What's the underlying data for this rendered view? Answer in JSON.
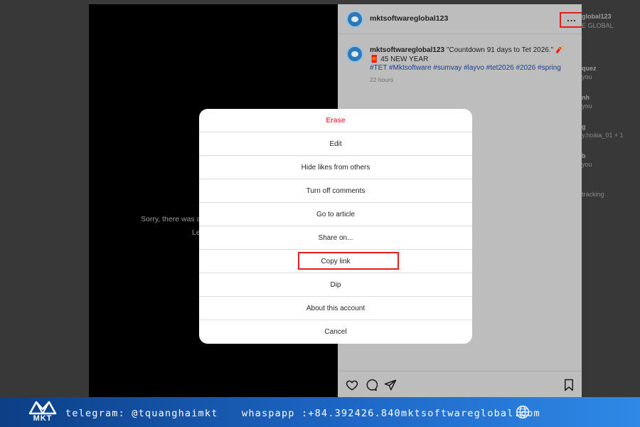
{
  "video": {
    "message_line1": "Sorry, there was a",
    "message_line2": "Le"
  },
  "post": {
    "author": "mktsoftwareglobal123",
    "more_label": "...",
    "caption_user": "mktsoftwareglobal123",
    "caption_text": "\"Countdown 91 days to Tet 2026.\" 🧨🧧 45 NEW YEAR",
    "hashtags": "#TET #Mktsoftware #sumvay #layvo #tet2026 #2026 #spring",
    "time_ago": "22 hours"
  },
  "right_column": {
    "items": [
      {
        "text": "global123",
        "bold": true
      },
      {
        "text": "E GLOBAL",
        "bold": false
      },
      {
        "text": "quez",
        "bold": true
      },
      {
        "text": "you",
        "bold": false
      },
      {
        "text": "nh",
        "bold": true
      },
      {
        "text": "you",
        "bold": false
      },
      {
        "text": "g",
        "bold": true
      },
      {
        "text": "y.hoàia_01 + 1",
        "bold": false
      },
      {
        "text": "b",
        "bold": true
      },
      {
        "text": "you",
        "bold": false
      },
      {
        "text": "tracking",
        "bold": false
      }
    ]
  },
  "modal": {
    "items": [
      {
        "label": "Erase",
        "kind": "danger"
      },
      {
        "label": "Edit",
        "kind": "normal"
      },
      {
        "label": "Hide likes from others",
        "kind": "normal"
      },
      {
        "label": "Turn off comments",
        "kind": "normal"
      },
      {
        "label": "Go to article",
        "kind": "normal"
      },
      {
        "label": "Share on...",
        "kind": "normal"
      },
      {
        "label": "Copy link",
        "kind": "highlight"
      },
      {
        "label": "Dip",
        "kind": "normal"
      },
      {
        "label": "About this account",
        "kind": "normal"
      },
      {
        "label": "Cancel",
        "kind": "normal"
      }
    ]
  },
  "footer": {
    "logo_text": "MKT",
    "telegram": "telegram: @tquanghaimkt",
    "whatsapp": "whaspapp :+84.392426.840",
    "website": "mktsoftwareglobal.com"
  },
  "colors": {
    "danger": "#ed4956",
    "highlight_border": "#e02020",
    "footer_start": "#0b3f86",
    "footer_end": "#2f89e6"
  }
}
